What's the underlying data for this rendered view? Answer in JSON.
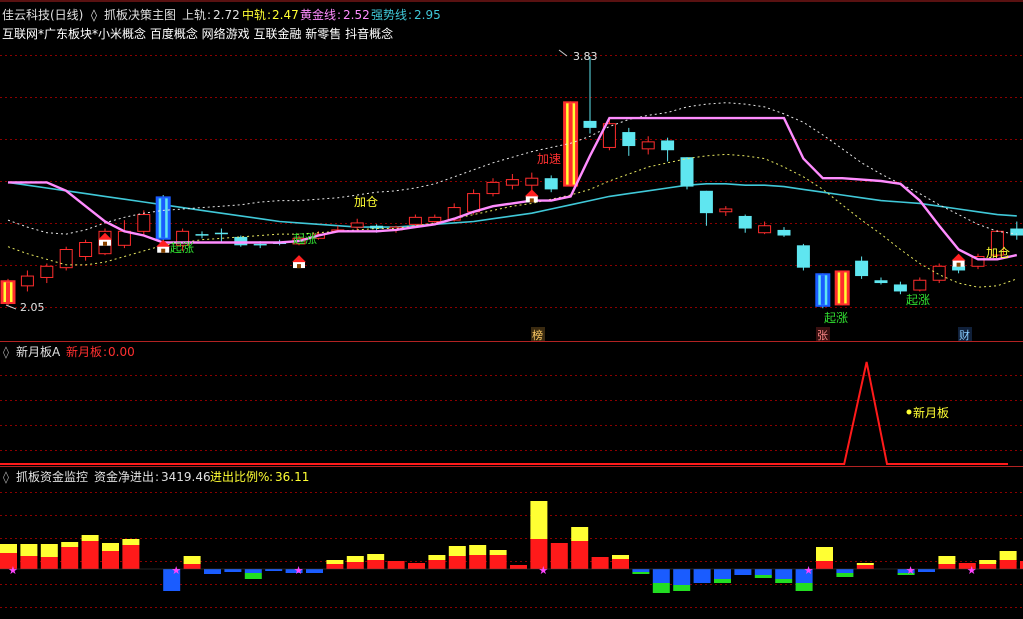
{
  "colors": {
    "background": "#000000",
    "grid": "#8b0000",
    "separator": "#b22222",
    "candle_up": "#ff2d2d",
    "candle_down": "#5fe6f0",
    "pink_line": "#ff8cff",
    "cyan_line": "#40c8d8",
    "dotted_white": "#e8e8e8",
    "dotted_yellow": "#e8e860",
    "yellow_text": "#ffff33",
    "green_text": "#30e030",
    "red_text": "#ff3030",
    "vol_red": "#ff1a1a",
    "vol_yellow": "#ffff33",
    "vol_blue": "#1a5cff",
    "vol_green": "#22dd22",
    "star": "#ff44ff"
  },
  "main_panel": {
    "title": "佳云科技(日线)",
    "indicator_name": "抓板决策主图",
    "upper_label": "上轨",
    "upper_value": "2.72",
    "mid_label": "中轨",
    "mid_value": "2.47",
    "gold_label": "黄金线",
    "gold_value": "2.52",
    "strong_label": "强势线",
    "strong_value": "2.95",
    "concepts": "互联网*广东板块*小米概念 百度概念 网络游戏 互联金融 新零售 抖音概念",
    "high_label": "3.83",
    "low_label": "2.05",
    "annotations": {
      "qizhang": "起涨",
      "jiacang": "加仓",
      "jiasu": "加速"
    },
    "bottom_tags": [
      "榜",
      "张",
      "财"
    ]
  },
  "panel2": {
    "title": "新月板A",
    "value_label": "新月板",
    "value": "0.00",
    "peak_label": "新月板"
  },
  "panel3": {
    "title": "抓板资金监控",
    "net_label": "资金净进出",
    "net_value": "3419.46",
    "ratio_label": "进出比例%",
    "ratio_value": "36.11"
  },
  "candles": [
    {
      "o": 2.06,
      "c": 2.23,
      "h": 2.24,
      "l": 2.05,
      "u": 1,
      "x": 1
    },
    {
      "o": 2.19,
      "c": 2.26,
      "h": 2.3,
      "l": 2.15,
      "u": 1
    },
    {
      "o": 2.25,
      "c": 2.33,
      "h": 2.35,
      "l": 2.21,
      "u": 1
    },
    {
      "o": 2.32,
      "c": 2.45,
      "h": 2.47,
      "l": 2.3,
      "u": 1
    },
    {
      "o": 2.4,
      "c": 2.5,
      "h": 2.52,
      "l": 2.37,
      "u": 1
    },
    {
      "o": 2.42,
      "c": 2.58,
      "h": 2.6,
      "l": 2.41,
      "u": 1
    },
    {
      "o": 2.48,
      "c": 2.58,
      "h": 2.66,
      "l": 2.46,
      "u": 1
    },
    {
      "o": 2.58,
      "c": 2.7,
      "h": 2.73,
      "l": 2.55,
      "u": 1
    },
    {
      "o": 2.83,
      "c": 2.52,
      "h": 2.84,
      "l": 2.5,
      "u": 0,
      "x": 1
    },
    {
      "o": 2.48,
      "c": 2.58,
      "h": 2.6,
      "l": 2.44,
      "u": 1
    },
    {
      "o": 2.56,
      "c": 2.55,
      "h": 2.58,
      "l": 2.53,
      "u": 0
    },
    {
      "o": 2.57,
      "c": 2.56,
      "h": 2.6,
      "l": 2.5,
      "u": 0
    },
    {
      "o": 2.54,
      "c": 2.48,
      "h": 2.55,
      "l": 2.47,
      "u": 0
    },
    {
      "o": 2.49,
      "c": 2.49,
      "h": 2.51,
      "l": 2.46,
      "u": 0
    },
    {
      "o": 2.5,
      "c": 2.49,
      "h": 2.52,
      "l": 2.48,
      "u": 0
    },
    {
      "o": 2.49,
      "c": 2.53,
      "h": 2.55,
      "l": 2.48,
      "u": 1
    },
    {
      "o": 2.53,
      "c": 2.56,
      "h": 2.58,
      "l": 2.52,
      "u": 1
    },
    {
      "o": 2.58,
      "c": 2.59,
      "h": 2.62,
      "l": 2.57,
      "u": 1
    },
    {
      "o": 2.61,
      "c": 2.64,
      "h": 2.67,
      "l": 2.59,
      "u": 1
    },
    {
      "o": 2.62,
      "c": 2.6,
      "h": 2.63,
      "l": 2.57,
      "u": 0
    },
    {
      "o": 2.59,
      "c": 2.61,
      "h": 2.62,
      "l": 2.57,
      "u": 1
    },
    {
      "o": 2.63,
      "c": 2.68,
      "h": 2.7,
      "l": 2.61,
      "u": 1
    },
    {
      "o": 2.65,
      "c": 2.68,
      "h": 2.7,
      "l": 2.64,
      "u": 1
    },
    {
      "o": 2.66,
      "c": 2.75,
      "h": 2.78,
      "l": 2.65,
      "u": 1
    },
    {
      "o": 2.72,
      "c": 2.85,
      "h": 2.88,
      "l": 2.7,
      "u": 1
    },
    {
      "o": 2.85,
      "c": 2.93,
      "h": 2.96,
      "l": 2.83,
      "u": 1
    },
    {
      "o": 2.91,
      "c": 2.95,
      "h": 2.99,
      "l": 2.88,
      "u": 1
    },
    {
      "o": 2.91,
      "c": 2.96,
      "h": 3.0,
      "l": 2.87,
      "u": 1
    },
    {
      "o": 2.96,
      "c": 2.88,
      "h": 2.98,
      "l": 2.86,
      "u": 0
    },
    {
      "o": 2.9,
      "c": 3.51,
      "h": 3.51,
      "l": 2.9,
      "u": 1,
      "x": 1
    },
    {
      "o": 3.37,
      "c": 3.32,
      "h": 3.83,
      "l": 3.28,
      "u": 0
    },
    {
      "o": 3.18,
      "c": 3.35,
      "h": 3.38,
      "l": 3.16,
      "u": 1
    },
    {
      "o": 3.29,
      "c": 3.19,
      "h": 3.32,
      "l": 3.12,
      "u": 0
    },
    {
      "o": 3.17,
      "c": 3.22,
      "h": 3.26,
      "l": 3.13,
      "u": 1
    },
    {
      "o": 3.23,
      "c": 3.16,
      "h": 3.25,
      "l": 3.08,
      "u": 0
    },
    {
      "o": 3.11,
      "c": 2.9,
      "h": 3.11,
      "l": 2.88,
      "u": 0
    },
    {
      "o": 2.87,
      "c": 2.71,
      "h": 2.87,
      "l": 2.62,
      "u": 0
    },
    {
      "o": 2.72,
      "c": 2.74,
      "h": 2.76,
      "l": 2.69,
      "u": 1
    },
    {
      "o": 2.69,
      "c": 2.6,
      "h": 2.7,
      "l": 2.57,
      "u": 0
    },
    {
      "o": 2.57,
      "c": 2.62,
      "h": 2.65,
      "l": 2.56,
      "u": 1
    },
    {
      "o": 2.59,
      "c": 2.55,
      "h": 2.61,
      "l": 2.54,
      "u": 0
    },
    {
      "o": 2.48,
      "c": 2.32,
      "h": 2.49,
      "l": 2.3,
      "u": 0
    },
    {
      "o": 2.28,
      "c": 2.04,
      "h": 2.28,
      "l": 2.03,
      "u": 0,
      "x": 1
    },
    {
      "o": 2.05,
      "c": 2.3,
      "h": 2.3,
      "l": 2.05,
      "u": 1,
      "x": 1
    },
    {
      "o": 2.37,
      "c": 2.26,
      "h": 2.4,
      "l": 2.24,
      "u": 0
    },
    {
      "o": 2.23,
      "c": 2.21,
      "h": 2.25,
      "l": 2.2,
      "u": 0
    },
    {
      "o": 2.2,
      "c": 2.15,
      "h": 2.22,
      "l": 2.13,
      "u": 0
    },
    {
      "o": 2.16,
      "c": 2.23,
      "h": 2.25,
      "l": 2.15,
      "u": 1
    },
    {
      "o": 2.23,
      "c": 2.33,
      "h": 2.35,
      "l": 2.21,
      "u": 1
    },
    {
      "o": 2.3,
      "c": 2.33,
      "h": 2.36,
      "l": 2.28,
      "u": 0
    },
    {
      "o": 2.33,
      "c": 2.4,
      "h": 2.42,
      "l": 2.31,
      "u": 1
    },
    {
      "o": 2.41,
      "c": 2.58,
      "h": 2.59,
      "l": 2.4,
      "u": 1
    },
    {
      "o": 2.55,
      "c": 2.6,
      "h": 2.65,
      "l": 2.52,
      "u": 0
    }
  ],
  "lines": {
    "pink": [
      2.93,
      2.93,
      2.93,
      2.87,
      2.76,
      2.65,
      2.58,
      2.55,
      2.5,
      2.5,
      2.5,
      2.5,
      2.5,
      2.5,
      2.5,
      2.51,
      2.55,
      2.58,
      2.58,
      2.58,
      2.59,
      2.61,
      2.63,
      2.67,
      2.72,
      2.76,
      2.78,
      2.8,
      2.8,
      2.83,
      3.12,
      3.39,
      3.39,
      3.39,
      3.39,
      3.39,
      3.39,
      3.39,
      3.39,
      3.39,
      3.39,
      3.1,
      2.96,
      2.96,
      2.95,
      2.94,
      2.92,
      2.8,
      2.62,
      2.45,
      2.38,
      2.38,
      2.41
    ],
    "cyan": [
      2.93,
      2.91,
      2.89,
      2.87,
      2.85,
      2.83,
      2.81,
      2.79,
      2.77,
      2.75,
      2.73,
      2.71,
      2.69,
      2.67,
      2.65,
      2.64,
      2.63,
      2.62,
      2.61,
      2.61,
      2.61,
      2.62,
      2.63,
      2.64,
      2.65,
      2.67,
      2.69,
      2.71,
      2.74,
      2.77,
      2.8,
      2.83,
      2.85,
      2.87,
      2.89,
      2.91,
      2.92,
      2.92,
      2.91,
      2.91,
      2.9,
      2.88,
      2.86,
      2.84,
      2.82,
      2.8,
      2.79,
      2.78,
      2.76,
      2.74,
      2.72,
      2.7,
      2.69
    ],
    "white": [
      2.66,
      2.61,
      2.57,
      2.56,
      2.59,
      2.64,
      2.68,
      2.71,
      2.73,
      2.74,
      2.75,
      2.76,
      2.77,
      2.79,
      2.8,
      2.8,
      2.81,
      2.82,
      2.84,
      2.86,
      2.87,
      2.89,
      2.92,
      2.97,
      3.02,
      3.07,
      3.11,
      3.15,
      3.18,
      3.21,
      3.26,
      3.33,
      3.38,
      3.41,
      3.43,
      3.47,
      3.49,
      3.5,
      3.49,
      3.47,
      3.42,
      3.36,
      3.27,
      3.17,
      3.07,
      2.99,
      2.92,
      2.85,
      2.77,
      2.7,
      2.63,
      2.58,
      2.56
    ],
    "yellow": [
      2.47,
      2.42,
      2.38,
      2.34,
      2.34,
      2.36,
      2.4,
      2.44,
      2.48,
      2.5,
      2.52,
      2.53,
      2.54,
      2.55,
      2.56,
      2.56,
      2.57,
      2.58,
      2.59,
      2.6,
      2.6,
      2.62,
      2.64,
      2.67,
      2.7,
      2.73,
      2.76,
      2.78,
      2.81,
      2.84,
      2.88,
      2.94,
      2.99,
      3.04,
      3.07,
      3.1,
      3.12,
      3.13,
      3.12,
      3.1,
      3.04,
      2.97,
      2.88,
      2.77,
      2.66,
      2.56,
      2.45,
      2.35,
      2.27,
      2.21,
      2.18,
      2.19,
      2.24
    ]
  },
  "volume": [
    [
      16,
      9
    ],
    [
      13,
      12
    ],
    [
      12,
      13
    ],
    [
      22,
      5
    ],
    [
      28,
      6
    ],
    [
      18,
      8
    ],
    [
      24,
      6
    ],
    [
      0,
      0
    ],
    [
      -22,
      0
    ],
    [
      5,
      8
    ],
    [
      -5,
      0
    ],
    [
      -3,
      0
    ],
    [
      -4,
      -6
    ],
    [
      -2,
      0
    ],
    [
      -4,
      0
    ],
    [
      -4,
      0
    ],
    [
      5,
      4
    ],
    [
      7,
      6
    ],
    [
      9,
      6
    ],
    [
      8,
      0
    ],
    [
      6,
      0
    ],
    [
      9,
      5
    ],
    [
      13,
      10
    ],
    [
      14,
      10
    ],
    [
      14,
      5
    ],
    [
      4,
      0
    ],
    [
      30,
      38
    ],
    [
      26,
      0
    ],
    [
      28,
      14
    ],
    [
      12,
      0
    ],
    [
      10,
      4
    ],
    [
      -3,
      -2
    ],
    [
      -14,
      -10
    ],
    [
      -16,
      -6
    ],
    [
      -14,
      0
    ],
    [
      -10,
      -4
    ],
    [
      -6,
      0
    ],
    [
      -6,
      -3
    ],
    [
      -10,
      -4
    ],
    [
      -14,
      -8
    ],
    [
      8,
      14
    ],
    [
      -4,
      -4
    ],
    [
      4,
      2
    ],
    [
      0,
      0
    ],
    [
      -4,
      -2
    ],
    [
      -3,
      6
    ],
    [
      5,
      8
    ],
    [
      6,
      0
    ],
    [
      5,
      4
    ],
    [
      9,
      9
    ],
    [
      8,
      0
    ]
  ],
  "stars": [
    0,
    8,
    14,
    26,
    39,
    44,
    47
  ],
  "pulse": {
    "start": 43,
    "peak": 44,
    "end": 45
  }
}
